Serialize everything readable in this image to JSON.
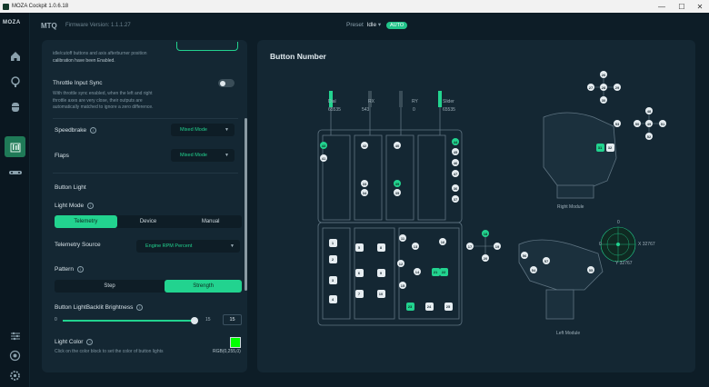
{
  "window": {
    "title": "MOZA Cockpit 1.0.6.18",
    "controls": [
      "—",
      "☐",
      "✕"
    ]
  },
  "sidebar": {
    "logo": "MOZA",
    "items": [
      {
        "icon": "home-icon"
      },
      {
        "icon": "wheelbase-icon"
      },
      {
        "icon": "pedals-icon"
      },
      {
        "icon": "throttle-icon",
        "active": true
      },
      {
        "icon": "stick-icon"
      }
    ],
    "bottom_items": [
      {
        "icon": "sliders-icon"
      },
      {
        "icon": "help-icon"
      },
      {
        "icon": "gear-icon"
      }
    ]
  },
  "header": {
    "device": "MTQ",
    "firmware": "Firmware Version: 1.1.1.27",
    "preset_label": "Preset",
    "preset_value": "Idle",
    "auto_badge": "AUTO"
  },
  "left": {
    "intro_text_1": "idle/cutoff buttons and axis afterburner position",
    "intro_text_2": "calibration have been Enabled.",
    "sync_title": "Throttle Input Sync",
    "sync_desc_1": "With throttle sync enabled, when the left and right",
    "sync_desc_2": "throttle axes are very close, their outputs are",
    "sync_desc_3": "automatically matched to ignore a zero difference.",
    "speedbrake_label": "Speedbrake",
    "speedbrake_value": "Mixed Mode",
    "flaps_label": "Flaps",
    "flaps_value": "Mixed Mode",
    "button_light_title": "Button Light",
    "light_mode_label": "Light Mode",
    "light_modes": [
      "Telemetry",
      "Device",
      "Manual"
    ],
    "telemetry_source_label": "Telemetry Source",
    "telemetry_source_value": "Engine RPM Percent",
    "pattern_label": "Pattern",
    "patterns": [
      "Step",
      "Strength"
    ],
    "brightness_label": "Button LightBacklit Brightness",
    "brightness_min": "0",
    "brightness_max": "15",
    "brightness_value": "15",
    "light_color_label": "Light Color",
    "light_color_hint": "Click on the color block to set the color of button lights",
    "light_color_value": "RGB(0,255,0)"
  },
  "right": {
    "title": "Button Number",
    "axes": [
      {
        "name": "Dial",
        "value": "65535"
      },
      {
        "name": "RX",
        "value": "543"
      },
      {
        "name": "RY",
        "value": "0"
      },
      {
        "name": "Slider",
        "value": "65535"
      }
    ],
    "right_module_label": "Right Module",
    "left_module_label": "Left Module",
    "stick_x": "X 32767",
    "stick_y": "Y 32767",
    "stick_zero": "0",
    "btn_labels": {
      "b1": "1",
      "b2": "2",
      "b3": "3",
      "b4": "4",
      "b5": "5",
      "b6": "6",
      "b7": "7",
      "b8": "8",
      "b9": "9",
      "b10": "10",
      "b11": "11",
      "b12": "12",
      "b13": "13",
      "b14": "14",
      "b15": "15",
      "b16": "16",
      "b17": "17",
      "b18": "18",
      "b19": "19",
      "b20": "20",
      "b21": "21",
      "b22": "22",
      "b23": "23",
      "b24": "24",
      "b25": "25",
      "b26": "26",
      "b27": "27",
      "b28": "28",
      "b29": "29",
      "b30": "30",
      "b31": "31",
      "b32": "32",
      "b33": "33",
      "b34": "34",
      "b35": "35",
      "b36": "36",
      "b37": "37",
      "b38": "38",
      "b39": "39",
      "b40": "40",
      "b41": "41",
      "b42": "42",
      "b43": "43",
      "b44": "44",
      "b45": "45",
      "b46": "46",
      "b47": "47",
      "b48": "48",
      "b49": "49",
      "b50": "50",
      "b51": "51",
      "b52": "52",
      "b53": "53",
      "b54": "54",
      "b55": "55",
      "b56": "56",
      "b57": "57",
      "b58": "58",
      "b59": "59",
      "b60": "60"
    }
  },
  "colors": {
    "accent": "#22d38f",
    "bg": "#0d1d27",
    "panel": "#142733"
  }
}
